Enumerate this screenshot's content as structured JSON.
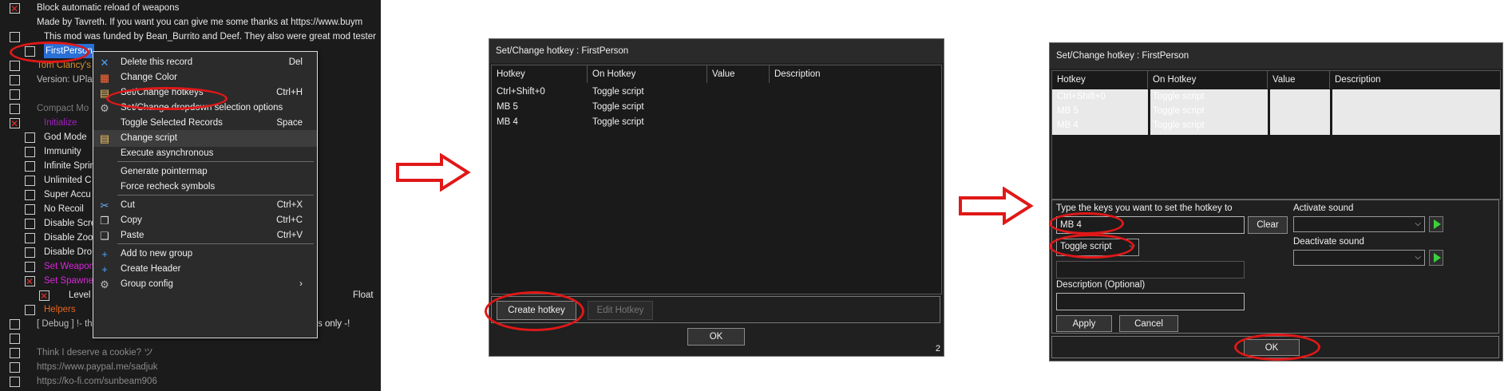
{
  "panel1": {
    "rows": [
      {
        "text": "Block automatic reload of weapons",
        "check": "x",
        "color": "#e8e8e8"
      },
      {
        "text": "Made by Tavreth. If you want you can give me some thanks at https://www.buym",
        "check": "none",
        "color": "#e8e8e8"
      },
      {
        "text": "This mod was funded by Bean_Burrito and Deef. They also were great mod tester",
        "check": "box",
        "color": "#e8e8e8"
      },
      {
        "text": "FirstPerson",
        "check": "box",
        "color": "#ffffff",
        "selected": true
      },
      {
        "text": "Tom Clancy's",
        "check": "box",
        "color": "#d8902a"
      },
      {
        "text": "Version: UPla",
        "check": "box",
        "color": "#bdbdbd"
      },
      {
        "text": "",
        "check": "box",
        "color": "#e8e8e8"
      },
      {
        "text": "Compact Mo",
        "check": "box",
        "color": "#7a7a7a"
      },
      {
        "text": "Initialize",
        "check": "x",
        "color": "#a020c0"
      },
      {
        "text": "God Mode",
        "check": "box",
        "color": "#e8e8e8"
      },
      {
        "text": "Immunity",
        "check": "box",
        "color": "#e8e8e8"
      },
      {
        "text": "Infinite Sprin",
        "check": "box",
        "color": "#e8e8e8"
      },
      {
        "text": "Unlimited C",
        "check": "box",
        "color": "#e8e8e8"
      },
      {
        "text": "Super Accu",
        "check": "box",
        "color": "#e8e8e8"
      },
      {
        "text": "No Recoil",
        "check": "box",
        "color": "#e8e8e8"
      },
      {
        "text": "Disable Scre",
        "check": "box",
        "color": "#e8e8e8"
      },
      {
        "text": "Disable Zoo",
        "check": "box",
        "color": "#e8e8e8"
      },
      {
        "text": "Disable Dro",
        "check": "box",
        "color": "#e8e8e8"
      },
      {
        "text": "Set Weapon",
        "check": "box",
        "color": "#d826d8"
      },
      {
        "text": "Set Spawner",
        "check": "x",
        "color": "#d826d8"
      },
      {
        "text": "Level",
        "check": "x",
        "color": "#e8e8e8",
        "extra": "Float"
      },
      {
        "text": "Helpers",
        "check": "box",
        "color": "#e6651e"
      },
      {
        "text": "[ Debug ] !- th",
        "check": "box",
        "color": "#bdbdbd",
        "extra": "s only -!"
      },
      {
        "text": "",
        "check": "box",
        "color": "#e8e8e8"
      },
      {
        "text": "Think I deserve a cookie? ツ",
        "check": "box",
        "color": "#8a8a8a"
      },
      {
        "text": "https://www.paypal.me/sadjuk",
        "check": "box",
        "color": "#8a8a8a"
      },
      {
        "text": "https://ko-fi.com/sunbeam906",
        "check": "box",
        "color": "#8a8a8a"
      }
    ],
    "context_menu": [
      {
        "label": "Delete this record",
        "shortcut": "Del",
        "icon": "delete-icon"
      },
      {
        "label": "Change Color",
        "shortcut": "",
        "icon": "color-palette-icon"
      },
      {
        "label": "Set/Change hotkeys",
        "shortcut": "Ctrl+H",
        "icon": "hotkey-icon"
      },
      {
        "label": "Set/Change dropdown selection options",
        "shortcut": "",
        "icon": "gear-icon"
      },
      {
        "label": "Toggle Selected Records",
        "shortcut": "Space",
        "icon": ""
      },
      {
        "label": "Change script",
        "shortcut": "",
        "icon": "script-icon"
      },
      {
        "label": "Execute asynchronous",
        "shortcut": "",
        "icon": ""
      },
      {
        "label": "Generate pointermap",
        "shortcut": "",
        "icon": ""
      },
      {
        "label": "Force recheck symbols",
        "shortcut": "",
        "icon": ""
      },
      {
        "label": "Cut",
        "shortcut": "Ctrl+X",
        "icon": "scissors-icon"
      },
      {
        "label": "Copy",
        "shortcut": "Ctrl+C",
        "icon": "copy-icon"
      },
      {
        "label": "Paste",
        "shortcut": "Ctrl+V",
        "icon": "paste-icon"
      },
      {
        "label": "Add to new group",
        "shortcut": "",
        "icon": "plus-icon"
      },
      {
        "label": "Create Header",
        "shortcut": "",
        "icon": "plus-icon"
      },
      {
        "label": "Group config",
        "shortcut": "›",
        "icon": "gear-icon"
      }
    ]
  },
  "dialog2": {
    "title": "Set/Change hotkey : FirstPerson",
    "columns": [
      "Hotkey",
      "On Hotkey",
      "Value",
      "Description"
    ],
    "rows": [
      {
        "hotkey": "Ctrl+Shift+0",
        "on": "Toggle script"
      },
      {
        "hotkey": "MB 5",
        "on": "Toggle script"
      },
      {
        "hotkey": "MB 4",
        "on": "Toggle script"
      }
    ],
    "create_button": "Create hotkey",
    "edit_button": "Edit Hotkey",
    "ok_button": "OK",
    "corner_number": "2"
  },
  "dialog3": {
    "title": "Set/Change hotkey : FirstPerson",
    "columns": [
      "Hotkey",
      "On Hotkey",
      "Value",
      "Description"
    ],
    "rows": [
      {
        "hotkey": "Ctrl+Shift+0",
        "on": "Toggle script"
      },
      {
        "hotkey": "MB 5",
        "on": "Toggle script"
      },
      {
        "hotkey": "MB 4",
        "on": "Toggle script"
      }
    ],
    "keys_label": "Type the keys you want to set the hotkey to",
    "keys_value": "MB 4",
    "clear_button": "Clear",
    "action_value": "Toggle script",
    "activate_sound_label": "Activate sound",
    "deactivate_sound_label": "Deactivate sound",
    "description_label": "Description (Optional)",
    "apply_button": "Apply",
    "cancel_button": "Cancel",
    "ok_button": "OK"
  },
  "colors": {
    "annotation": "#e01818",
    "selection": "#2a6fd6"
  }
}
